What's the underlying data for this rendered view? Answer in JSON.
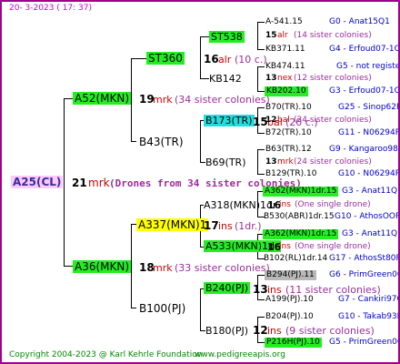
{
  "header": {
    "date": "20-   3-2023 (  17:  37)"
  },
  "footer": {
    "copyright": "Copyright 2004-2023 @ Karl Kehrle Foundation",
    "site": "www.pedigreeapis.org"
  },
  "root": {
    "label": "A25(CL)",
    "count": "21",
    "mark": "mrk",
    "note": "(Drones from 34 sister colonies)"
  },
  "p1": {
    "label": "A52(MKN)",
    "count": "19",
    "mark": "mrk",
    "note": "(34 sister colonies)"
  },
  "p2": {
    "label": "A36(MKN)",
    "count": "18",
    "mark": "mrk",
    "note": "(33 sister colonies)"
  },
  "g1": {
    "label": "ST360",
    "count": "16",
    "mark": "alr",
    "note": "(10 c.)"
  },
  "g2": {
    "label": "B43(TR)"
  },
  "g3": {
    "label": "A337(MKN)1",
    "count": "17",
    "mark": "ins",
    "note": "(1dr.)"
  },
  "g4": {
    "label": "B100(PJ)"
  },
  "gg1": {
    "label": "ST538"
  },
  "gg2": {
    "label": "KB142"
  },
  "gg3": {
    "label": "B173(TR)",
    "count": "15",
    "mark": "bal",
    "note": "(20 c.)"
  },
  "gg4": {
    "label": "B69(TR)"
  },
  "gg5": {
    "label": "A318(MKN)1dr",
    "count": "16",
    "mark": "ins",
    "note": "(One single drone)"
  },
  "gg6": {
    "label": "A533(MKN)1dr",
    "count": "16",
    "mark": "ins",
    "note": "(One single drone)"
  },
  "gg7": {
    "label": "B240(PJ)",
    "count": "13",
    "mark": "ins",
    "note": "(11 sister colonies)"
  },
  "gg8": {
    "label": "B180(PJ)",
    "count": "12",
    "mark": "ins",
    "note": "(9 sister colonies)"
  },
  "rows": [
    {
      "a": "A-541.15",
      "b": "G0 - Anat15Q1"
    },
    {
      "c": "15",
      "m": "alr",
      "n": "(14 sister colonies)"
    },
    {
      "a": "KB371.11",
      "b": "G4 - Erfoud07-1Q"
    },
    {
      "a": "KB474.11",
      "b": "G5 - not registe"
    },
    {
      "c": "13",
      "m": "nex",
      "n": "(12 sister colonies)"
    },
    {
      "a": "KB202.10",
      "b": "G3 - Erfoud07-1Q"
    },
    {
      "a": "B70(TR).10",
      "b": "G25 - Sinop62R"
    },
    {
      "c": "12",
      "m": "bal",
      "n": "(24 sister colonies)"
    },
    {
      "a": "B72(TR).10",
      "b": "G11 - N06294R"
    },
    {
      "a": "B63(TR).12",
      "b": "G9 - Kangaroo98R"
    },
    {
      "c": "13",
      "m": "mrk",
      "n": "(24 sister colonies)"
    },
    {
      "a": "B129(TR).10",
      "b": "G10 - N06294R"
    },
    {
      "a": "A362(MKN)1dr.15",
      "b": "G3 - Anat11Q"
    },
    {
      "a": "B530(ABR)1dr.15",
      "b": "G10 - AthosOOR"
    },
    {
      "a": "A362(MKN)1dr.15",
      "b": "G3 - Anat11Q"
    },
    {
      "a": "B102(RL)1dr.14",
      "b": "G17 - AthosSt80R"
    },
    {
      "a": "B294(PJ).11",
      "b": "G6 - PrimGreen00"
    },
    {
      "a": "A199(PJ).10",
      "b": "G7 - Cankiri97Q"
    },
    {
      "a": "B204(PJ).10",
      "b": "G10 - Takab93R"
    },
    {
      "a": "P216H(PJ).10",
      "b": "G5 - PrimGreen00"
    }
  ]
}
